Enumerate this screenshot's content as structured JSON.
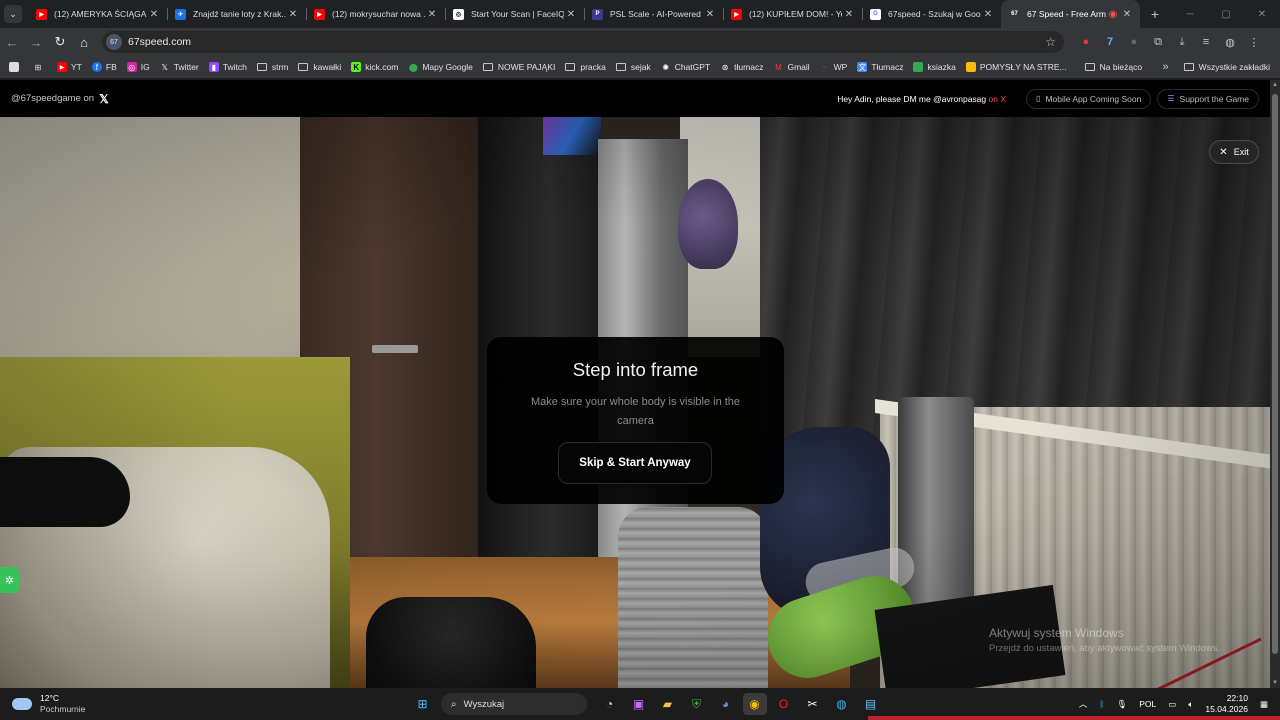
{
  "browser": {
    "tab_list_icon": "chevron-down-icon",
    "tabs": [
      {
        "title": "(12) AMERYKA ŚCIĄGA P...",
        "icon": "youtube-icon",
        "color": "#ff0000"
      },
      {
        "title": "Znajdź tanie loty z Krak...",
        "icon": "flights-icon",
        "color": "#1a73e8"
      },
      {
        "title": "(12) mokrysuchar nowa ...",
        "icon": "youtube-icon",
        "color": "#ff0000"
      },
      {
        "title": "Start Your Scan | FaceIQ L...",
        "icon": "faceiq-icon",
        "color": "#ffffff"
      },
      {
        "title": "PSL Scale - AI-Powered F...",
        "icon": "psl-icon",
        "color": "#3b3b8f"
      },
      {
        "title": "(12) KUPIŁEM DOM! - You...",
        "icon": "youtube-icon",
        "color": "#ff0000"
      },
      {
        "title": "67speed - Szukaj w Goog...",
        "icon": "google-icon",
        "color": "#ffffff"
      },
      {
        "title": "67 Speed - Free Arm",
        "icon": "site-67-icon",
        "color": "#35363a",
        "active": true
      }
    ],
    "new_tab": "+",
    "url": "67speed.com",
    "site_badge": "67",
    "bookmarks": [
      {
        "label": "YT",
        "icon": "youtube-icon"
      },
      {
        "label": "FB",
        "icon": "facebook-icon"
      },
      {
        "label": "IG",
        "icon": "instagram-icon"
      },
      {
        "label": "Twitter",
        "icon": "x-icon"
      },
      {
        "label": "Twitch",
        "icon": "twitch-icon"
      },
      {
        "label": "strm",
        "icon": "folder-icon"
      },
      {
        "label": "kawałki",
        "icon": "folder-icon"
      },
      {
        "label": "kick.com",
        "icon": "kick-icon"
      },
      {
        "label": "Mapy Google",
        "icon": "maps-icon"
      },
      {
        "label": "NOWE PAJĄKI",
        "icon": "folder-icon"
      },
      {
        "label": "pracka",
        "icon": "folder-icon"
      },
      {
        "label": "sejak",
        "icon": "folder-icon"
      },
      {
        "label": "ChatGPT",
        "icon": "chatgpt-icon"
      },
      {
        "label": "tłumacz",
        "icon": "translate-icon"
      },
      {
        "label": "Gmail",
        "icon": "gmail-icon"
      },
      {
        "label": "WP",
        "icon": "wp-icon"
      },
      {
        "label": "Tłumacz",
        "icon": "translate-icon"
      },
      {
        "label": "ksiazka",
        "icon": "book-icon"
      },
      {
        "label": "POMYSŁY NA STRE...",
        "icon": "docs-icon"
      },
      {
        "label": "Na bieżąco",
        "icon": "folder-icon"
      }
    ],
    "bookmarks_more": "»",
    "all_bookmarks": "Wszystkie zakładki"
  },
  "site": {
    "handle": "@67speedgame on",
    "dm_text": "Hey Adin, please DM me @avronpasag",
    "dm_suffix": "on X",
    "mobile_pill": "Mobile App Coming Soon",
    "support_pill": "Support the Game",
    "exit_label": "Exit",
    "modal": {
      "title": "Step into frame",
      "subtitle": "Make sure your whole body is visible in the camera",
      "button": "Skip & Start Anyway"
    }
  },
  "watermark": {
    "title": "Aktywuj system Windows",
    "subtitle": "Przejdź do ustawień, aby aktywować system Windows."
  },
  "taskbar": {
    "temperature": "12°C",
    "condition": "Pochmurnie",
    "search_placeholder": "Wyszukaj",
    "language": "POL",
    "time": "22:10",
    "date": "15.04.2026"
  },
  "colors": {
    "accent_green": "#36c35a",
    "x_red": "#ff4d4d",
    "support_blue": "#7b9cff"
  }
}
